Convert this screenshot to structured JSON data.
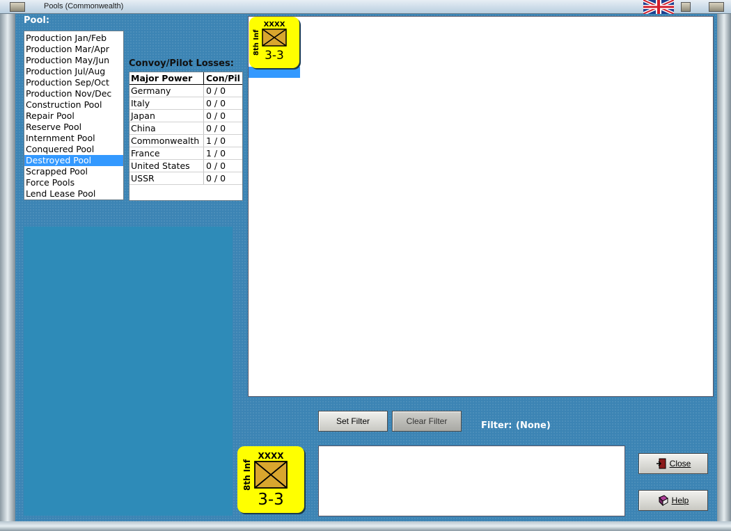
{
  "window": {
    "title": "Pools (Commonwealth)"
  },
  "pool": {
    "label": "Pool:",
    "items": [
      "Production Jan/Feb",
      "Production Mar/Apr",
      "Production May/Jun",
      "Production Jul/Aug",
      "Production Sep/Oct",
      "Production Nov/Dec",
      "Construction Pool",
      "Repair Pool",
      "Reserve Pool",
      "Internment Pool",
      "Conquered Pool",
      "Destroyed Pool",
      "Scrapped Pool",
      "Force Pools",
      "Lend Lease Pool"
    ],
    "selected": "Destroyed Pool"
  },
  "losses": {
    "label": "Convoy/Pilot Losses:",
    "headers": [
      "Major Power",
      "Con/Pil"
    ],
    "rows": [
      [
        "Germany",
        "0 / 0"
      ],
      [
        "Italy",
        "0 / 0"
      ],
      [
        "Japan",
        "0 / 0"
      ],
      [
        "China",
        "0 / 0"
      ],
      [
        "Commonwealth",
        "1 / 0"
      ],
      [
        "France",
        "1 / 0"
      ],
      [
        "United States",
        "0 / 0"
      ],
      [
        "USSR",
        "0 / 0"
      ]
    ]
  },
  "unit": {
    "name": "8th Inf",
    "size": "XXXX",
    "strength": "3-3",
    "color": "#ffff00"
  },
  "filter": {
    "set_label": "Set Filter",
    "clear_label": "Clear Filter",
    "label": "Filter:",
    "value": "(None)"
  },
  "buttons": {
    "close_label": "Close",
    "help_label": "Help"
  },
  "colors": {
    "selection": "#3399ff",
    "workspace": "#3c84b4",
    "panel": "#2e8bb8"
  }
}
